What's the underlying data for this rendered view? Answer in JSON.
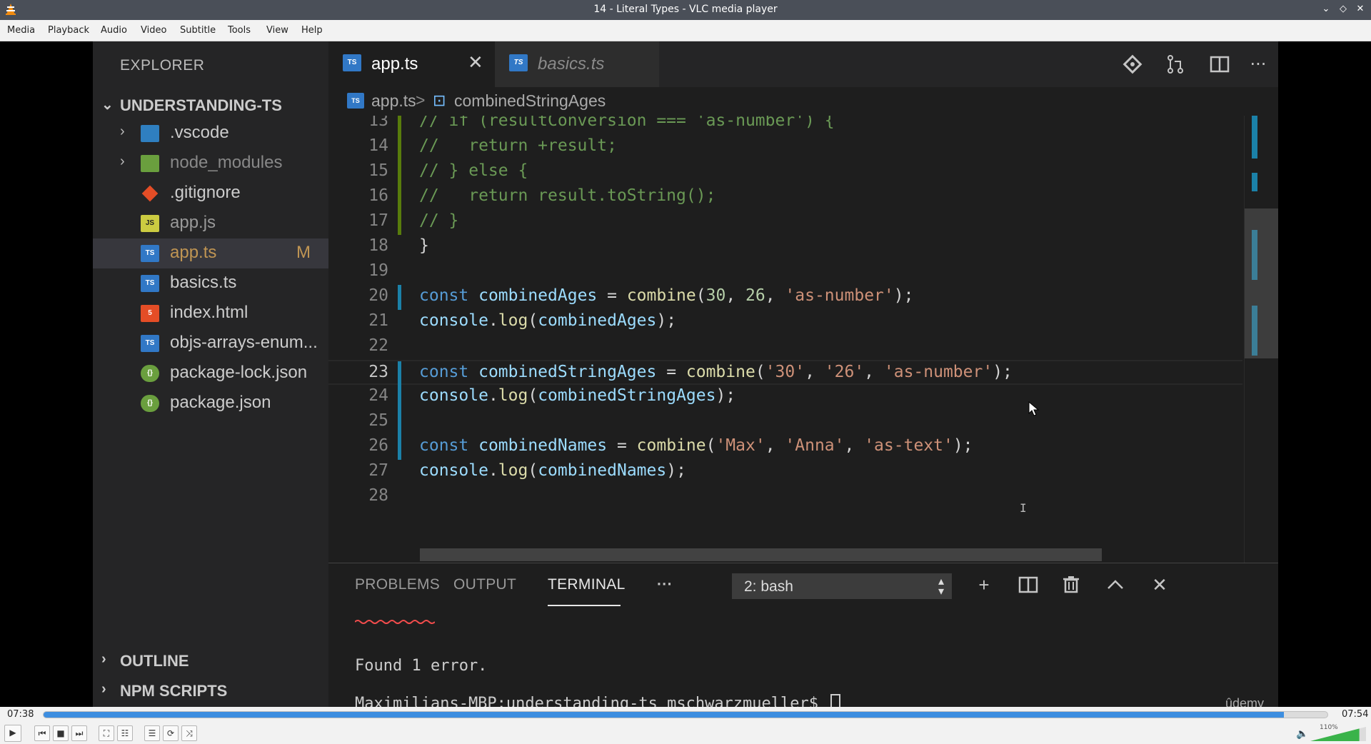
{
  "window": {
    "title": "14 - Literal Types - VLC media player",
    "controls": {
      "minimize": "⌄",
      "restore": "◇",
      "close": "✕"
    }
  },
  "menu": [
    "Media",
    "Playback",
    "Audio",
    "Video",
    "Subtitle",
    "Tools",
    "View",
    "Help"
  ],
  "vscode": {
    "explorer_title": "EXPLORER",
    "project": "UNDERSTANDING-TS",
    "files": [
      {
        "name": ".vscode",
        "icon": "vscode-folder-icon",
        "folder": true
      },
      {
        "name": "node_modules",
        "icon": "node-folder-icon",
        "folder": true
      },
      {
        "name": ".gitignore",
        "icon": "git-icon"
      },
      {
        "name": "app.js",
        "icon": "js-icon",
        "badge": "JS"
      },
      {
        "name": "app.ts",
        "icon": "ts-icon",
        "badge": "TS",
        "status": "M",
        "selected": true
      },
      {
        "name": "basics.ts",
        "icon": "ts-icon",
        "badge": "TS"
      },
      {
        "name": "index.html",
        "icon": "html-icon",
        "badge": "5"
      },
      {
        "name": "objs-arrays-enum...",
        "icon": "ts-icon",
        "badge": "TS"
      },
      {
        "name": "package-lock.json",
        "icon": "json-icon",
        "badge": "{}"
      },
      {
        "name": "package.json",
        "icon": "json-icon",
        "badge": "{}"
      }
    ],
    "outline": "OUTLINE",
    "npm_scripts": "NPM SCRIPTS",
    "tabs": [
      {
        "label": "app.ts",
        "badge": "TS",
        "active": true,
        "close": "✕"
      },
      {
        "label": "basics.ts",
        "badge": "TS",
        "active": false
      }
    ],
    "breadcrumb": {
      "file": "app.ts",
      "badge": "TS",
      "separator": ">",
      "symbol": "combinedStringAges",
      "symbol_icon": "⊡"
    },
    "editor_actions": {
      "git": "git-compare-icon",
      "compare": "pull-request-icon",
      "split": "split-editor-icon",
      "more": "···"
    },
    "code_lines": [
      {
        "n": "13",
        "gutter": "#587c0c",
        "tokens": [
          [
            "c",
            "// if (resultConversion === 'as-number') {"
          ]
        ]
      },
      {
        "n": "14",
        "gutter": "#587c0c",
        "tokens": [
          [
            "c",
            "//   return +result;"
          ]
        ]
      },
      {
        "n": "15",
        "gutter": "#587c0c",
        "tokens": [
          [
            "c",
            "// } else {"
          ]
        ]
      },
      {
        "n": "16",
        "gutter": "#587c0c",
        "tokens": [
          [
            "c",
            "//   return result.toString();"
          ]
        ]
      },
      {
        "n": "17",
        "gutter": "#587c0c",
        "tokens": [
          [
            "c",
            "// }"
          ]
        ]
      },
      {
        "n": "18",
        "tokens": [
          [
            "p",
            "}"
          ]
        ]
      },
      {
        "n": "19",
        "tokens": []
      },
      {
        "n": "20",
        "gutter": "#1b81a8",
        "tokens": [
          [
            "k",
            "const "
          ],
          [
            "v",
            "combinedAges"
          ],
          [
            "p",
            " = "
          ],
          [
            "f",
            "combine"
          ],
          [
            "p",
            "("
          ],
          [
            "n",
            "30"
          ],
          [
            "p",
            ", "
          ],
          [
            "n",
            "26"
          ],
          [
            "p",
            ", "
          ],
          [
            "s",
            "'as-number'"
          ],
          [
            "p",
            ");"
          ]
        ]
      },
      {
        "n": "21",
        "tokens": [
          [
            "v",
            "console"
          ],
          [
            "p",
            "."
          ],
          [
            "f",
            "log"
          ],
          [
            "p",
            "("
          ],
          [
            "v",
            "combinedAges"
          ],
          [
            "p",
            ");"
          ]
        ]
      },
      {
        "n": "22",
        "tokens": []
      },
      {
        "n": "23",
        "gutter": "#1b81a8",
        "current": true,
        "tokens": [
          [
            "k",
            "const "
          ],
          [
            "v",
            "combinedStringAges"
          ],
          [
            "p",
            " = "
          ],
          [
            "f",
            "combine"
          ],
          [
            "p",
            "("
          ],
          [
            "s",
            "'30'"
          ],
          [
            "p",
            ", "
          ],
          [
            "s",
            "'26'"
          ],
          [
            "p",
            ", "
          ],
          [
            "s",
            "'as-number'"
          ],
          [
            "p",
            ");"
          ]
        ]
      },
      {
        "n": "24",
        "gutter": "#1b81a8",
        "tokens": [
          [
            "v",
            "console"
          ],
          [
            "p",
            "."
          ],
          [
            "f",
            "log"
          ],
          [
            "p",
            "("
          ],
          [
            "v",
            "combinedStringAges"
          ],
          [
            "p",
            ");"
          ]
        ]
      },
      {
        "n": "25",
        "gutter": "#1b81a8",
        "tokens": []
      },
      {
        "n": "26",
        "gutter": "#1b81a8",
        "tokens": [
          [
            "k",
            "const "
          ],
          [
            "v",
            "combinedNames"
          ],
          [
            "p",
            " = "
          ],
          [
            "f",
            "combine"
          ],
          [
            "p",
            "("
          ],
          [
            "s",
            "'Max'"
          ],
          [
            "p",
            ", "
          ],
          [
            "s",
            "'Anna'"
          ],
          [
            "p",
            ", "
          ],
          [
            "s",
            "'as-text'"
          ],
          [
            "p",
            ");"
          ]
        ]
      },
      {
        "n": "27",
        "tokens": [
          [
            "v",
            "console"
          ],
          [
            "p",
            "."
          ],
          [
            "f",
            "log"
          ],
          [
            "p",
            "("
          ],
          [
            "v",
            "combinedNames"
          ],
          [
            "p",
            ");"
          ]
        ]
      },
      {
        "n": "28",
        "tokens": []
      }
    ],
    "active_line": "23",
    "panel": {
      "tabs": [
        "PROBLEMS",
        "OUTPUT",
        "TERMINAL"
      ],
      "active_tab": "TERMINAL",
      "more": "···",
      "terminal_select": "2: bash",
      "actions": {
        "new": "+",
        "split": "split-terminal-icon",
        "kill": "trash-icon",
        "maximize": "⌃",
        "close": "✕"
      },
      "terminal_lines": [
        "Found 1 error."
      ],
      "prompt": "Maximilians-MBP:understanding-ts mschwarzmueller$ "
    },
    "watermark": "ûdemy"
  },
  "player": {
    "elapsed": "07:38",
    "total": "07:54",
    "progress": 0.9663,
    "volume_percent_label": "110%",
    "volume": 1.1,
    "buttons": {
      "play": "▶",
      "prev": "⏮",
      "stop": "■",
      "next": "⏭",
      "fullscreen": "⛶",
      "extended": "☷",
      "playlist": "☰",
      "loop": "⟳",
      "shuffle": "⤨"
    }
  },
  "colors": {
    "accent_blue": "#3d8ee0",
    "ts_blue": "#3178c6",
    "modified": "#c09553"
  }
}
